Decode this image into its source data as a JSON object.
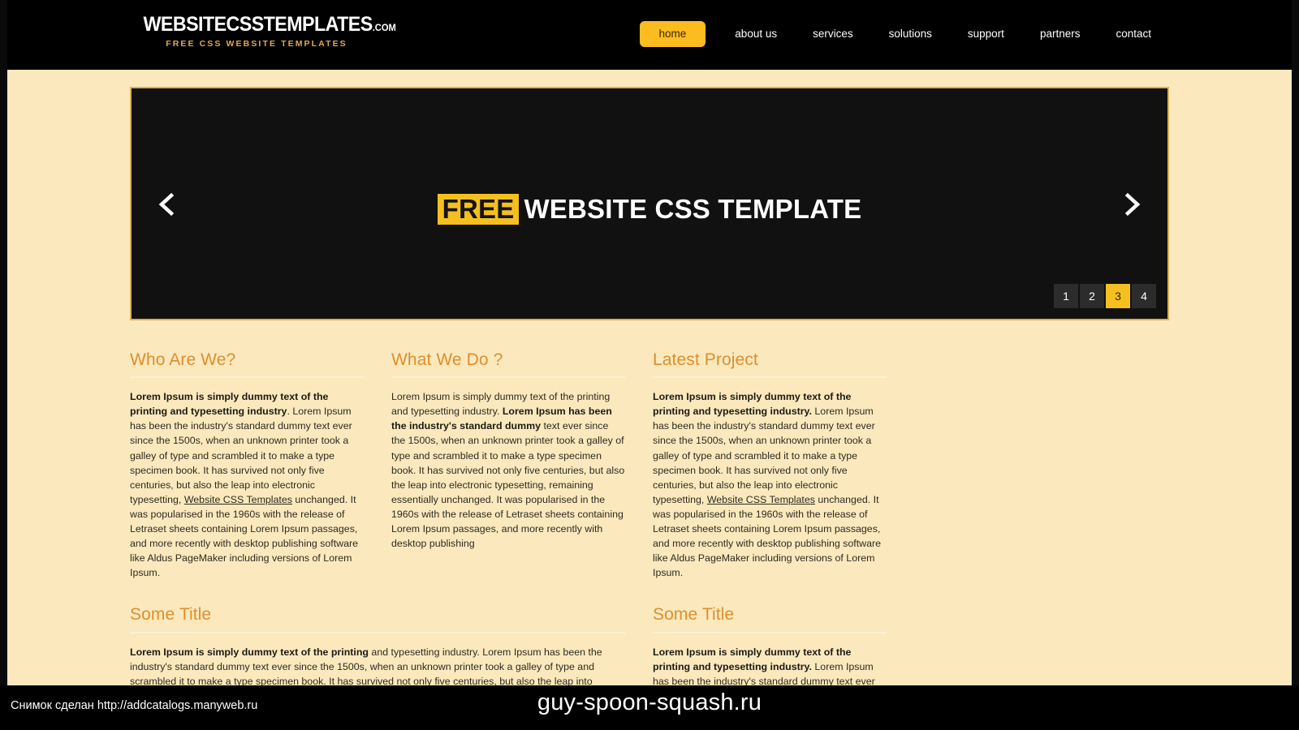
{
  "colors": {
    "page_background": "#fbe9bd",
    "header_background": "#000000",
    "accent_gold": "#fbbc1f",
    "banner_background": "#111111",
    "banner_border": "#d8b253",
    "heading_orange": "#de8e2f",
    "body_text": "#2e2a21"
  },
  "header": {
    "logo": {
      "main": "WEBSITECSSTEMPLATES",
      "suffix": ".COM",
      "tagline": "FREE CSS WEBSITE TEMPLATES"
    },
    "nav": [
      {
        "label": "home",
        "active": true
      },
      {
        "label": "about us",
        "active": false
      },
      {
        "label": "services",
        "active": false
      },
      {
        "label": "solutions",
        "active": false
      },
      {
        "label": "support",
        "active": false
      },
      {
        "label": "partners",
        "active": false
      },
      {
        "label": "contact",
        "active": false
      }
    ]
  },
  "banner": {
    "headline_highlight": "FREE",
    "headline_rest": "WEBSITE CSS TEMPLATE",
    "prev_icon": "chevron-left-icon",
    "next_icon": "chevron-right-icon",
    "pager": [
      {
        "label": "1",
        "active": false
      },
      {
        "label": "2",
        "active": false
      },
      {
        "label": "3",
        "active": true
      },
      {
        "label": "4",
        "active": false
      }
    ]
  },
  "columns": {
    "who_are_we": {
      "title": "Who Are We?",
      "bold_lead": "Lorem Ipsum is simply dummy text of the printing and typesetting industry",
      "body_1": ". Lorem Ipsum has been the industry's standard dummy text ever since the 1500s, when an unknown printer took a galley of type and scrambled it to make a type specimen book. It has survived not only five centuries, but also the leap into electronic typesetting, ",
      "link": "Website CSS Templates",
      "body_2": " unchanged. It was popularised in the 1960s with the release of Letraset sheets containing Lorem Ipsum passages, and more recently with desktop publishing software like Aldus PageMaker including versions of Lorem Ipsum."
    },
    "what_we_do": {
      "title": "What We Do ?",
      "body_1": "Lorem Ipsum is simply dummy text of the printing and typesetting industry. ",
      "bold_mid": "Lorem Ipsum has been the industry's standard dummy",
      "body_2": " text ever since the 1500s, when an unknown printer took a galley of type and scrambled it to make a type specimen book. It has survived not only five centuries, but also the leap into electronic typesetting, remaining essentially unchanged. It was popularised in the 1960s with the release of Letraset sheets containing Lorem Ipsum passages, and more recently with desktop publishing"
    },
    "latest_project": {
      "title": "Latest Project",
      "bold_lead": "Lorem Ipsum is simply dummy text of the printing and typesetting industry.",
      "body_1": " Lorem Ipsum has been the industry's standard dummy text ever since the 1500s, when an unknown printer took a galley of type and scrambled it to make a type specimen book. It has survived not only five centuries, but also the leap into electronic typesetting, ",
      "link": "Website CSS Templates",
      "body_2": " unchanged. It was popularised in the 1960s with the release of Letraset sheets containing Lorem Ipsum passages, and more recently with desktop publishing software like Aldus PageMaker including versions of Lorem Ipsum."
    },
    "some_title_left": {
      "title": "Some Title",
      "bold_lead": "Lorem Ipsum is simply dummy text of the printing",
      "body_1": " and typesetting industry. Lorem Ipsum has been the industry's standard dummy text ever since the 1500s, when an unknown printer took a galley of type and scrambled it to make a type specimen book. It has survived not only five centuries, but also the leap into electronic typesetting, remaining essentially unchanged. Website CSS Templates in the 1960s with the release of Letraset"
    },
    "some_title_right": {
      "title": "Some Title",
      "bold_lead": "Lorem Ipsum is simply dummy text of the printing and typesetting industry.",
      "body_1": " Lorem Ipsum has been the industry's standard dummy text ever since the 1500s, when an unknown Website CSS Templates and"
    }
  },
  "overlay": {
    "note": "Снимок сделан http://addcatalogs.manyweb.ru",
    "watermark": "guy-spoon-squash.ru"
  }
}
